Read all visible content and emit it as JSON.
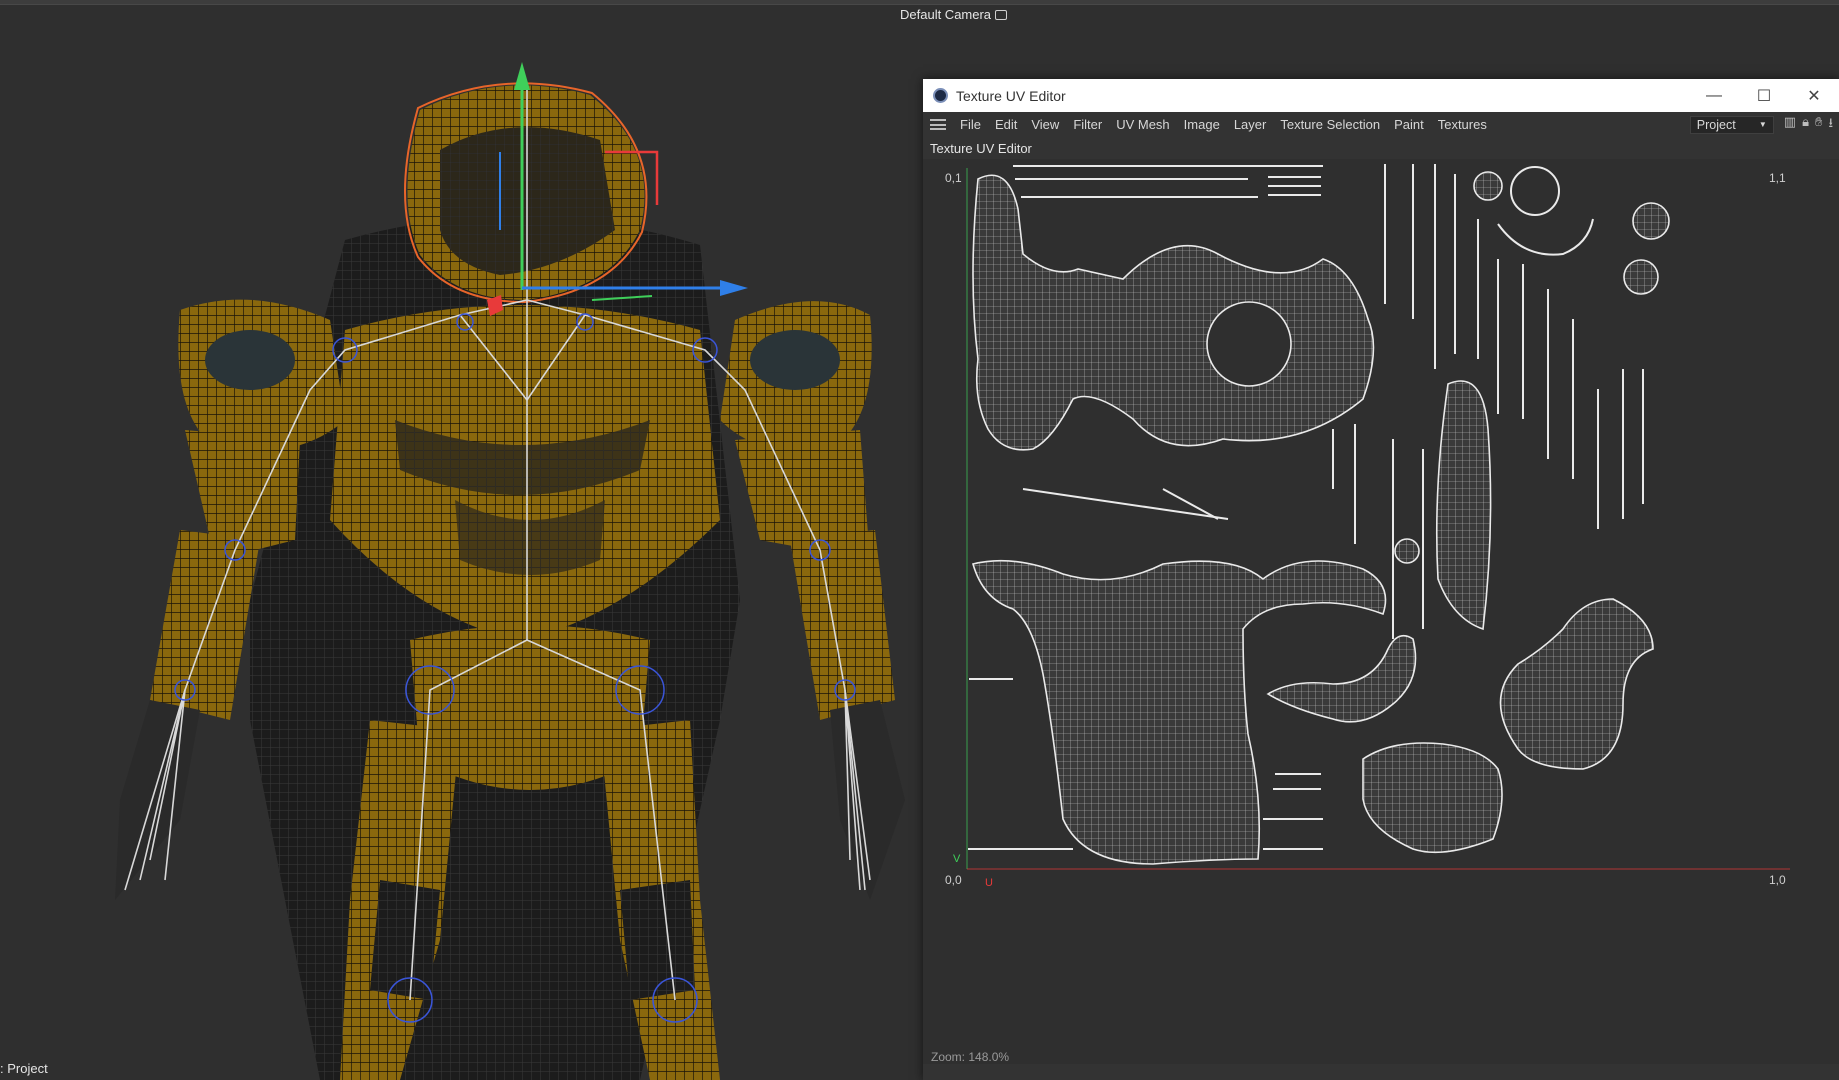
{
  "viewport": {
    "camera": "Default Camera",
    "bottom_label": ": Project"
  },
  "uv_editor": {
    "title": "Texture UV Editor",
    "window_buttons": [
      "—",
      "☐",
      "✕"
    ],
    "menu": [
      "File",
      "Edit",
      "View",
      "Filter",
      "UV Mesh",
      "Image",
      "Layer",
      "Texture Selection",
      "Paint",
      "Textures"
    ],
    "project_select": "Project",
    "toolbar_icons": [
      "graph-icon",
      "lock-icon",
      "hand-icon",
      "arrow-down-icon"
    ],
    "panel_label": "Texture UV Editor",
    "corners": {
      "top_left": "0,1",
      "top_right": "1,1",
      "bottom_left": "0,0",
      "bottom_right": "1,0",
      "v_axis": "V",
      "u_axis": "U"
    },
    "zoom_label": "Zoom: 148.0%"
  },
  "colors": {
    "background": "#2f2f2f",
    "armor": "#8c6a0c",
    "uv_lines": "#e0e0e0",
    "selection": "#e8652a",
    "axis_x": "#2f7fe8",
    "axis_y": "#3fcf5a",
    "axis_z": "#e83a3a"
  }
}
